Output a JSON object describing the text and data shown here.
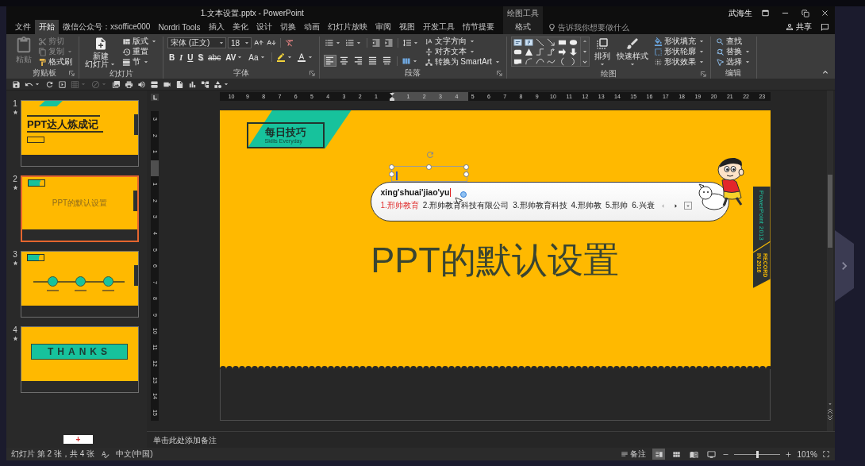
{
  "window": {
    "title": "1.文本设置.pptx - PowerPoint",
    "context_group": "绘图工具",
    "user": "武海生"
  },
  "tabs": [
    {
      "label": "文件",
      "selected": false
    },
    {
      "label": "开始",
      "selected": true
    },
    {
      "label": "微信公众号：xsoffice000",
      "selected": false
    },
    {
      "label": "Nordri Tools",
      "selected": false
    },
    {
      "label": "插入",
      "selected": false
    },
    {
      "label": "美化",
      "selected": false
    },
    {
      "label": "设计",
      "selected": false
    },
    {
      "label": "切换",
      "selected": false
    },
    {
      "label": "动画",
      "selected": false
    },
    {
      "label": "幻灯片放映",
      "selected": false
    },
    {
      "label": "审阅",
      "selected": false
    },
    {
      "label": "视图",
      "selected": false
    },
    {
      "label": "开发工具",
      "selected": false
    },
    {
      "label": "情节提要",
      "selected": false
    }
  ],
  "context_tab": {
    "label": "格式",
    "selected": false
  },
  "tell_me": {
    "placeholder": "告诉我你想要做什么"
  },
  "share": {
    "label": "共享"
  },
  "ribbon": {
    "groups": [
      {
        "kind": "clipboard",
        "label": "剪贴板",
        "items": [
          {
            "label": "粘贴",
            "disabled": true
          },
          {
            "label": "剪切",
            "disabled": true
          },
          {
            "label": "复制",
            "disabled": true
          },
          {
            "label": "格式刷",
            "disabled": false
          }
        ]
      },
      {
        "kind": "slides",
        "label": "幻灯片",
        "new_slide": [
          "新建",
          "幻灯片"
        ],
        "items": [
          {
            "label": "版式"
          },
          {
            "label": "重置"
          },
          {
            "label": "节"
          }
        ]
      },
      {
        "kind": "font",
        "label": "字体",
        "font_name": "宋体 (正文)",
        "font_size": "18",
        "glyphs": [
          "B",
          "I",
          "U",
          "S",
          "abc",
          "AV",
          "Aa"
        ]
      },
      {
        "kind": "paragraph",
        "label": "段落",
        "align": [
          {
            "selected": true
          },
          {
            "selected": false
          },
          {
            "selected": false
          },
          {
            "selected": false
          },
          {
            "selected": false
          }
        ],
        "items": [
          {
            "label": "文字方向"
          },
          {
            "label": "对齐文本"
          },
          {
            "label": "转换为 SmartArt"
          }
        ]
      },
      {
        "kind": "drawing",
        "label": "绘图",
        "large": [
          {
            "label": "排列"
          },
          {
            "label": "快速样式"
          }
        ],
        "items": [
          {
            "label": "形状填充"
          },
          {
            "label": "形状轮廓"
          },
          {
            "label": "形状效果"
          }
        ]
      },
      {
        "kind": "editing",
        "label": "编辑",
        "items": [
          {
            "label": "查找"
          },
          {
            "label": "替换"
          },
          {
            "label": "选择"
          }
        ]
      }
    ]
  },
  "quick_access": [
    {
      "disabled": false
    },
    {
      "disabled": false
    },
    {
      "disabled": false
    },
    {
      "disabled": false
    },
    {
      "disabled": true
    },
    {
      "disabled": true
    },
    {
      "disabled": false
    },
    {
      "disabled": false
    },
    {
      "disabled": false
    },
    {
      "disabled": false
    },
    {
      "disabled": false
    },
    {
      "disabled": false
    },
    {
      "disabled": false
    },
    {
      "disabled": false
    },
    {
      "disabled": false
    }
  ],
  "slides": [
    {
      "number": "1",
      "selected": false,
      "kind": "title",
      "title": "PPT达人炼成记"
    },
    {
      "number": "2",
      "selected": true,
      "kind": "section",
      "title": "PPT的默认设置"
    },
    {
      "number": "3",
      "selected": false,
      "kind": "timeline"
    },
    {
      "number": "4",
      "selected": false,
      "kind": "closing",
      "title": "THANKS"
    }
  ],
  "rulers": {
    "horizontal": {
      "before": [
        "10",
        "9",
        "8",
        "7",
        "6",
        "5",
        "4",
        "3",
        "2",
        "1"
      ],
      "after": [
        "1",
        "2",
        "3",
        "4",
        "5",
        "6",
        "7",
        "8",
        "9",
        "10",
        "11",
        "12",
        "13",
        "14",
        "15",
        "16",
        "17",
        "18",
        "19",
        "20",
        "21",
        "22",
        "23"
      ]
    },
    "vertical": {
      "before": [
        "3",
        "2",
        "1"
      ],
      "after": [
        "1",
        "2",
        "3",
        "4",
        "5",
        "6",
        "7",
        "8",
        "9",
        "10",
        "11",
        "12",
        "13",
        "14",
        "15"
      ]
    }
  },
  "slide": {
    "badge": {
      "title": "每日技巧",
      "subtitle": "Skills Everyday"
    },
    "title": "PPT的默认设置",
    "side_tag": {
      "top": "PowerPoint 2013",
      "bottom": [
        "RECORD",
        "IN 2016"
      ]
    }
  },
  "ime": {
    "composition": "xing'shuai'jiao'yu",
    "candidates": [
      {
        "label": "1.邢帅教育",
        "selected": true
      },
      {
        "label": "2.邢帅教育科技有限公司",
        "selected": false
      },
      {
        "label": "3.邢帅教育科技",
        "selected": false
      },
      {
        "label": "4.邢帅教",
        "selected": false
      },
      {
        "label": "5.邢帅",
        "selected": false
      },
      {
        "label": "6.兴衰",
        "selected": false
      }
    ]
  },
  "add_button": {
    "label": "+"
  },
  "notes": {
    "placeholder": "单击此处添加备注"
  },
  "status_bar": {
    "slide_info": "幻灯片 第 2 张，共 4 张",
    "language": "中文(中国)",
    "notes": "备注",
    "views": [
      {
        "selected": true
      },
      {
        "selected": false
      },
      {
        "selected": false
      },
      {
        "selected": false
      }
    ],
    "zoom_slider": {
      "level": 0.5
    },
    "zoom": "101%"
  }
}
